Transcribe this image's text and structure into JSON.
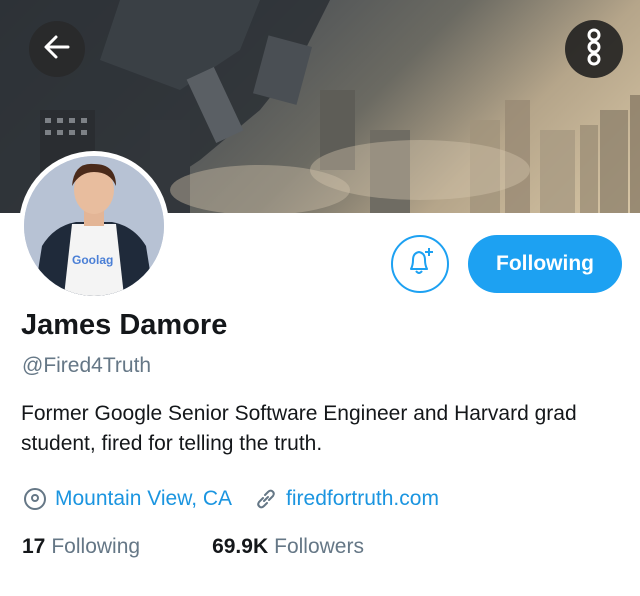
{
  "profile": {
    "name": "James Damore",
    "handle": "@Fired4Truth",
    "bio": "Former Google Senior Software Engineer and Harvard grad student, fired for telling the truth.",
    "location": "Mountain View, CA",
    "website": "firedfortruth.com",
    "following_count": "17",
    "following_label": "Following",
    "followers_count": "69.9K",
    "followers_label": "Followers",
    "shirt_text": "Goolag"
  },
  "actions": {
    "follow_button_label": "Following"
  },
  "icons": {
    "back": "arrow-left-icon",
    "more": "more-options-icon",
    "notify": "bell-plus-icon",
    "location": "location-pin-icon",
    "link": "link-icon"
  },
  "colors": {
    "accent": "#1da1f2",
    "link": "#1b95e0",
    "secondary_text": "#657786",
    "primary_text": "#14171a"
  }
}
